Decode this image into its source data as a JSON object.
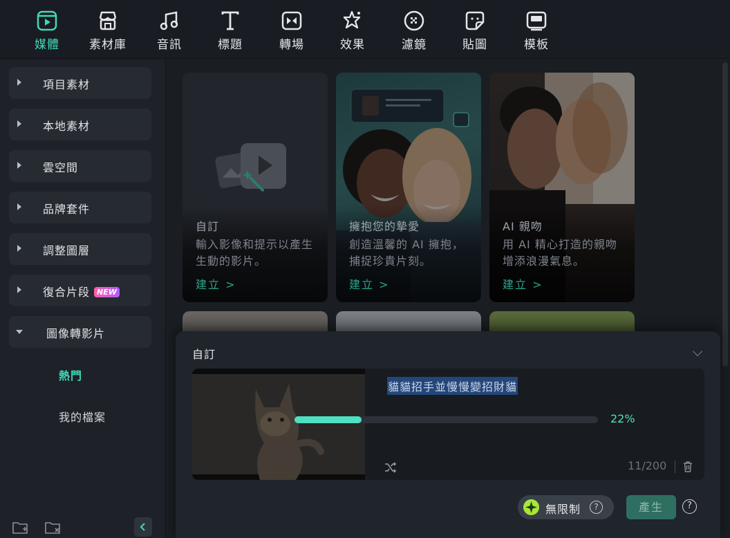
{
  "toolbar": {
    "tabs": [
      {
        "label": "媒體",
        "icon": "media-icon",
        "active": true
      },
      {
        "label": "素材庫",
        "icon": "store-icon"
      },
      {
        "label": "音訊",
        "icon": "music-note-icon"
      },
      {
        "label": "標題",
        "icon": "text-t-icon"
      },
      {
        "label": "轉場",
        "icon": "transition-icon"
      },
      {
        "label": "效果",
        "icon": "effects-star-icon"
      },
      {
        "label": "濾鏡",
        "icon": "filter-icon"
      },
      {
        "label": "貼圖",
        "icon": "sticker-icon"
      },
      {
        "label": "模板",
        "icon": "template-icon"
      }
    ]
  },
  "sidebar": {
    "items": [
      {
        "label": "項目素材"
      },
      {
        "label": "本地素材"
      },
      {
        "label": "雲空間"
      },
      {
        "label": "品牌套件"
      },
      {
        "label": "調整圖層"
      },
      {
        "label": "復合片段",
        "badge": "NEW"
      },
      {
        "label": "圖像轉影片",
        "expanded": true
      }
    ],
    "subitems": [
      {
        "label": "熱門",
        "active": true
      },
      {
        "label": "我的檔案"
      }
    ]
  },
  "cards": [
    {
      "title": "自訂",
      "desc": "輸入影像和提示以產生生動的影片。",
      "action": "建立 >"
    },
    {
      "title": "擁抱您的摯愛",
      "desc": "創造溫馨的 AI 擁抱，捕捉珍貴片刻。",
      "action": "建立 >"
    },
    {
      "title": "AI 親吻",
      "desc": "用 AI 精心打造的親吻增添浪漫氣息。",
      "action": "建立 >"
    }
  ],
  "panel": {
    "title": "自訂",
    "prompt": "貓貓招手並慢慢變招財貓",
    "progress_percent": 22,
    "progress_label": "22%",
    "counter": "11/200",
    "unlimited_label": "無限制",
    "generate_label": "產生",
    "help_glyph": "?"
  },
  "colors": {
    "accent": "#3fd9b7",
    "progress": "#4ee0c0",
    "new_badge_start": "#ff5fa8",
    "new_badge_end": "#b05cff"
  }
}
